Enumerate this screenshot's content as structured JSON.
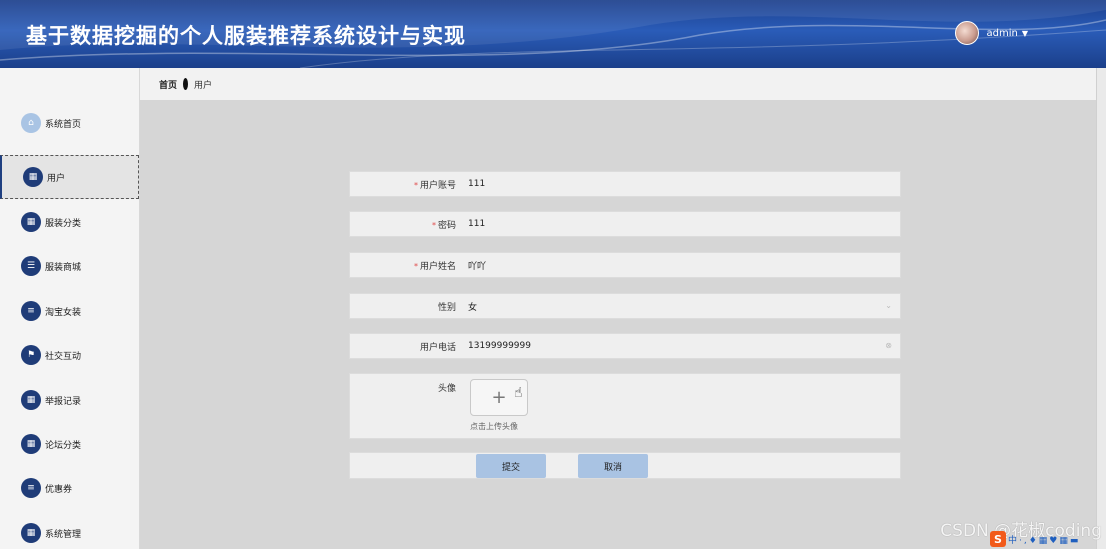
{
  "header": {
    "title": "基于数据挖掘的个人服装推荐系统设计与实现",
    "username": "admin",
    "caret": "▼"
  },
  "breadcrumb": {
    "home": "首页",
    "current": "用户"
  },
  "sidebar": {
    "items": [
      {
        "label": "系统首页",
        "icon": "home-icon",
        "glyph": "⌂",
        "active": false
      },
      {
        "label": "用户",
        "icon": "grid-icon",
        "glyph": "▦",
        "active": true
      },
      {
        "label": "服装分类",
        "icon": "grid-icon",
        "glyph": "▦",
        "active": false
      },
      {
        "label": "服装商城",
        "icon": "sliders-icon",
        "glyph": "☰",
        "active": false
      },
      {
        "label": "淘宝女装",
        "icon": "list-icon",
        "glyph": "≡",
        "active": false
      },
      {
        "label": "社交互动",
        "icon": "flag-icon",
        "glyph": "⚑",
        "active": false
      },
      {
        "label": "举报记录",
        "icon": "grid-icon",
        "glyph": "▦",
        "active": false
      },
      {
        "label": "论坛分类",
        "icon": "grid-icon",
        "glyph": "▦",
        "active": false
      },
      {
        "label": "优惠券",
        "icon": "list-icon",
        "glyph": "≡",
        "active": false
      },
      {
        "label": "系统管理",
        "icon": "grid-icon",
        "glyph": "▦",
        "active": false
      }
    ]
  },
  "form": {
    "account": {
      "label": "用户账号",
      "required": "*",
      "value": "111"
    },
    "password": {
      "label": "密码",
      "required": "*",
      "value": "111"
    },
    "name": {
      "label": "用户姓名",
      "required": "*",
      "value": "吖吖"
    },
    "gender": {
      "label": "性别",
      "value": "女",
      "icon": "chevron-down-icon",
      "glyph": "⌄"
    },
    "phone": {
      "label": "用户电话",
      "value": "13199999999",
      "icon": "clear-icon",
      "glyph": "⊗"
    },
    "avatar": {
      "label": "头像",
      "plus": "+",
      "hint": "点击上传头像"
    }
  },
  "buttons": {
    "submit": "提交",
    "cancel": "取消"
  },
  "overlay": {
    "watermark": "CSDN @花椒coding",
    "ime_logo": "S",
    "ime_text": "中·,♦▦♥▦▬"
  },
  "colors": {
    "header_bg": "#2a5cb8",
    "nav_icon": "#1f3c78",
    "button": "#a9c3e3",
    "required": "#e04b4b"
  }
}
